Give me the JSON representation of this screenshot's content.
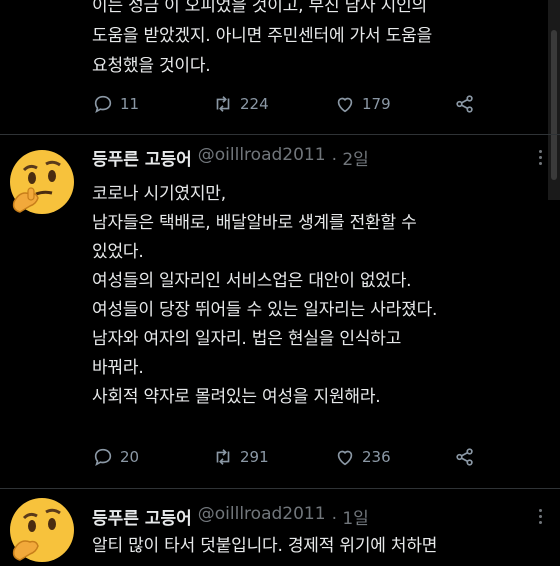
{
  "tweet1": {
    "lines": [
      "이는 성금 이 오피었을 것이고, 부진 남자 지인의",
      "도움을 받았겠지.  아니면 주민센터에 가서 도움을",
      "요청했을 것이다."
    ],
    "reply_count": "11",
    "retweet_count": "224",
    "like_count": "179"
  },
  "tweet2": {
    "display_name": "등푸른 고등어",
    "handle": "@oilllroad2011",
    "time": "· 2일",
    "lines": [
      "코로나 시기였지만,",
      "남자들은 택배로, 배달알바로 생계를 전환할 수",
      "있었다.",
      "여성들의 일자리인 서비스업은 대안이 없었다.",
      "여성들이 당장 뛰어들 수 있는 일자리는 사라졌다.",
      "남자와 여자의 일자리. 법은 현실을 인식하고",
      "바꿔라.",
      "사회적 약자로 몰려있는 여성을 지원해라."
    ],
    "reply_count": "20",
    "retweet_count": "291",
    "like_count": "236"
  },
  "tweet3": {
    "display_name": "등푸른 고등어",
    "handle": "@oilllroad2011",
    "time": "· 1일",
    "lines": [
      "알티 많이 타서 덧붙입니다. 경제적 위기에 처하면"
    ]
  },
  "icons": {
    "reply": "reply-icon",
    "retweet": "retweet-icon",
    "like": "like-icon",
    "share": "share-icon",
    "avatar": "thinking-face-emoji"
  },
  "colors": {
    "background": "#000000",
    "text": "#e7e9ea",
    "secondary": "#71767b",
    "divider": "#2f3336"
  }
}
